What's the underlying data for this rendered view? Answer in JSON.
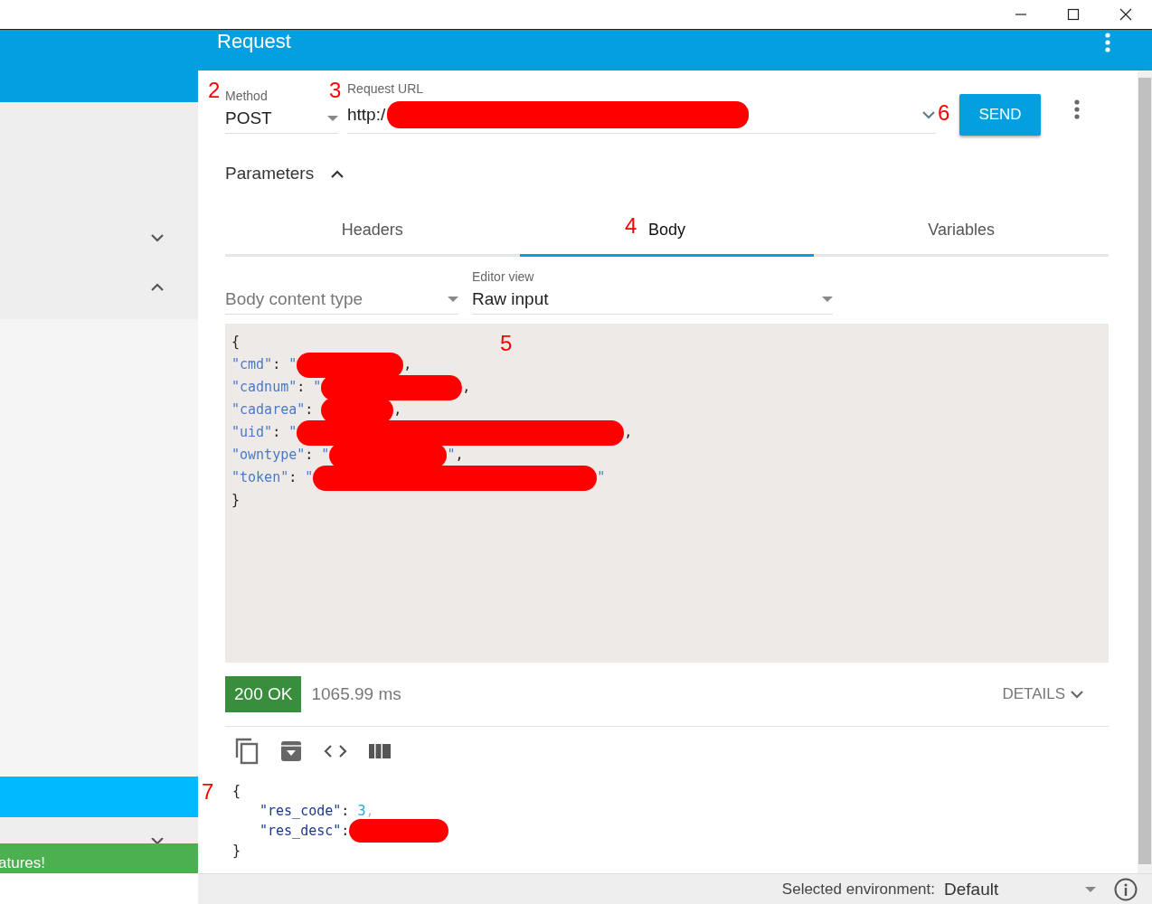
{
  "header": {
    "title": "Request"
  },
  "sidebar": {
    "banner": "atures!"
  },
  "request": {
    "method": {
      "label": "Method",
      "value": "POST"
    },
    "url": {
      "label": "Request URL",
      "value": "http:/",
      "redacted": true
    },
    "send": "SEND"
  },
  "parameters": {
    "label": "Parameters",
    "expanded": true
  },
  "tabs": [
    {
      "label": "Headers",
      "selected": false
    },
    {
      "label": "Body",
      "selected": true
    },
    {
      "label": "Variables",
      "selected": false
    }
  ],
  "body_content_type": {
    "placeholder": "Body content type"
  },
  "editor_view": {
    "label": "Editor view",
    "value": "Raw input"
  },
  "body_lines": [
    {
      "parts": [
        {
          "kind": "punct",
          "text": "{"
        }
      ]
    },
    {
      "parts": [
        {
          "kind": "key",
          "text": "\"cmd\""
        },
        {
          "kind": "punct",
          "text": ": "
        },
        {
          "kind": "string",
          "text": "\""
        },
        {
          "kind": "redacted"
        },
        {
          "kind": "punct",
          "text": ","
        }
      ]
    },
    {
      "parts": [
        {
          "kind": "key",
          "text": "\"cadnum\""
        },
        {
          "kind": "punct",
          "text": ": "
        },
        {
          "kind": "string",
          "text": "\""
        },
        {
          "kind": "redacted"
        },
        {
          "kind": "punct",
          "text": ","
        }
      ]
    },
    {
      "parts": [
        {
          "kind": "key",
          "text": "\"cadarea\""
        },
        {
          "kind": "punct",
          "text": ": "
        },
        {
          "kind": "redacted"
        },
        {
          "kind": "punct",
          "text": ","
        }
      ]
    },
    {
      "parts": [
        {
          "kind": "key",
          "text": "\"uid\""
        },
        {
          "kind": "punct",
          "text": ": "
        },
        {
          "kind": "string",
          "text": "\""
        },
        {
          "kind": "redacted"
        },
        {
          "kind": "punct",
          "text": ","
        }
      ]
    },
    {
      "parts": [
        {
          "kind": "key",
          "text": "\"owntype\""
        },
        {
          "kind": "punct",
          "text": ": "
        },
        {
          "kind": "string",
          "text": "\""
        },
        {
          "kind": "redacted"
        },
        {
          "kind": "string",
          "text": "\""
        },
        {
          "kind": "punct",
          "text": ","
        }
      ]
    },
    {
      "parts": [
        {
          "kind": "key",
          "text": "\"token\""
        },
        {
          "kind": "punct",
          "text": ": "
        },
        {
          "kind": "string",
          "text": "\""
        },
        {
          "kind": "redacted"
        },
        {
          "kind": "string",
          "text": "\""
        }
      ]
    },
    {
      "parts": [
        {
          "kind": "punct",
          "text": "}"
        }
      ]
    }
  ],
  "response": {
    "status": "200 OK",
    "time": "1065.99 ms",
    "details": "DETAILS"
  },
  "response_lines": [
    {
      "parts": [
        {
          "kind": "punct",
          "text": "{"
        }
      ]
    },
    {
      "parts": [
        {
          "kind": "key",
          "text": "\"res_code\""
        },
        {
          "kind": "punct",
          "text": ": "
        },
        {
          "kind": "number",
          "text": "3"
        },
        {
          "kind": "faint",
          "text": ","
        }
      ]
    },
    {
      "parts": [
        {
          "kind": "key",
          "text": "\"res_desc\""
        },
        {
          "kind": "punct",
          "text": ":"
        },
        {
          "kind": "redacted"
        }
      ]
    },
    {
      "parts": [
        {
          "kind": "punct",
          "text": "}"
        }
      ]
    }
  ],
  "annotations": [
    {
      "text": "2"
    },
    {
      "text": "3"
    },
    {
      "text": "6"
    },
    {
      "text": "4"
    },
    {
      "text": "5"
    },
    {
      "text": "7"
    }
  ],
  "footer": {
    "label": "Selected environment:",
    "value": "Default"
  }
}
